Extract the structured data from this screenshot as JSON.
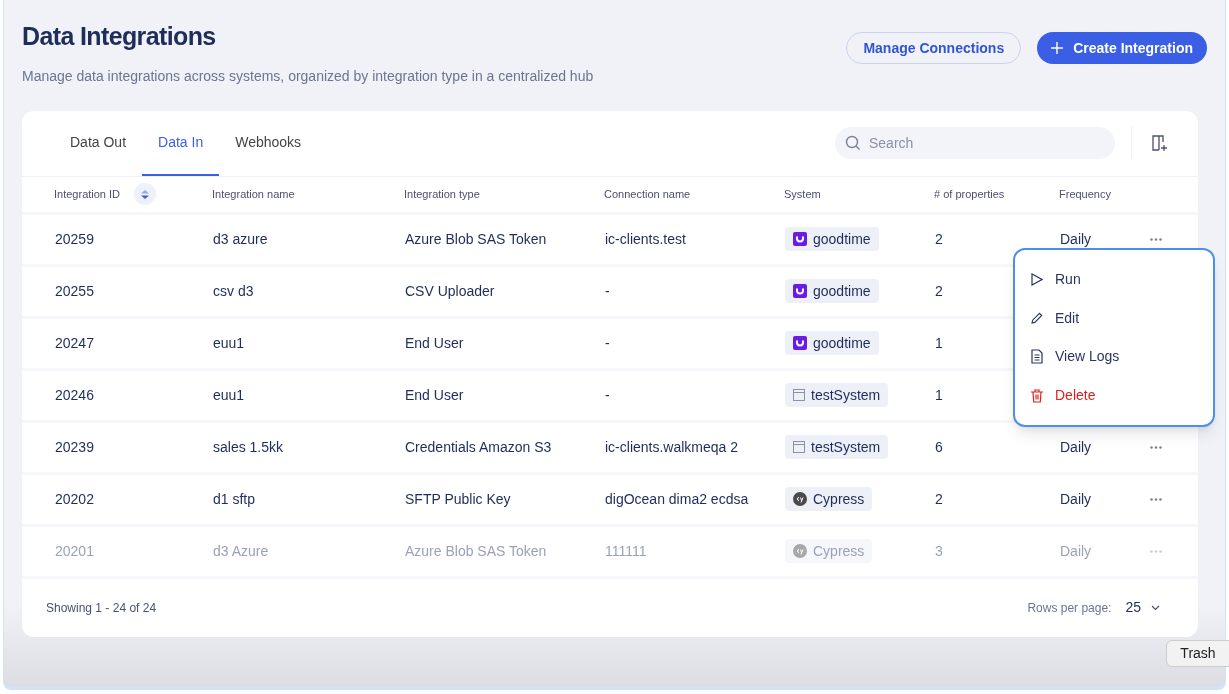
{
  "header": {
    "title": "Data Integrations",
    "subtitle": "Manage data integrations across systems, organized by integration type in a centralized hub"
  },
  "actions": [
    {
      "kind": "outline",
      "label": "Manage Connections"
    },
    {
      "kind": "primary",
      "label": "Create Integration"
    }
  ],
  "tabs": [
    {
      "label": "Data Out",
      "selected": false
    },
    {
      "label": "Data In",
      "selected": true
    },
    {
      "label": "Webhooks",
      "selected": false
    }
  ],
  "search": {
    "placeholder": "Search"
  },
  "table": {
    "columns": [
      "Integration ID",
      "Integration name",
      "Integration type",
      "Connection name",
      "System",
      "# of properties",
      "Frequency"
    ],
    "rows": [
      {
        "id": "20259",
        "name": "d3 azure",
        "type": "Azure Blob SAS Token",
        "connection": "ic-clients.test",
        "system": {
          "kind": "brand-u",
          "label": "goodtime"
        },
        "properties": "2",
        "frequency": "Daily",
        "dimmed": false
      },
      {
        "id": "20255",
        "name": "csv d3",
        "type": "CSV Uploader",
        "connection": "-",
        "system": {
          "kind": "brand-u",
          "label": "goodtime"
        },
        "properties": "2",
        "dimmed": false
      },
      {
        "id": "20247",
        "name": "euu1",
        "type": "End User",
        "connection": "-",
        "system": {
          "kind": "brand-u",
          "label": "goodtime"
        },
        "properties": "1",
        "dimmed": false
      },
      {
        "id": "20246",
        "name": "euu1",
        "type": "End User",
        "connection": "-",
        "system": {
          "kind": "window",
          "label": "testSystem"
        },
        "properties": "1",
        "dimmed": false
      },
      {
        "id": "20239",
        "name": "sales 1.5kk",
        "type": "Credentials Amazon S3",
        "connection": "ic-clients.walkmeqa 2",
        "system": {
          "kind": "window",
          "label": "testSystem"
        },
        "properties": "6",
        "frequency": "Daily",
        "dimmed": false
      },
      {
        "id": "20202",
        "name": "d1 sftp",
        "type": "SFTP Public Key",
        "connection": "digOcean dima2 ecdsa",
        "system": {
          "kind": "brand-cy",
          "label": "Cypress"
        },
        "properties": "2",
        "frequency": "Daily",
        "dimmed": false
      },
      {
        "id": "20201",
        "name": "d3 Azure",
        "type": "Azure Blob SAS Token",
        "connection": "111111",
        "system": {
          "kind": "brand-cy",
          "label": "Cypress"
        },
        "properties": "3",
        "frequency": "Daily",
        "dimmed": true
      }
    ]
  },
  "footer": {
    "showing": "Showing 1 - 24 of 24",
    "rows_per_page_label": "Rows per page:",
    "rows_per_page": "25"
  },
  "menu": {
    "items": [
      {
        "kind": "run",
        "label": "Run"
      },
      {
        "kind": "edit",
        "label": "Edit"
      },
      {
        "kind": "logs",
        "label": "View Logs"
      },
      {
        "kind": "delete",
        "label": "Delete"
      }
    ]
  },
  "tooltip": "Trash"
}
